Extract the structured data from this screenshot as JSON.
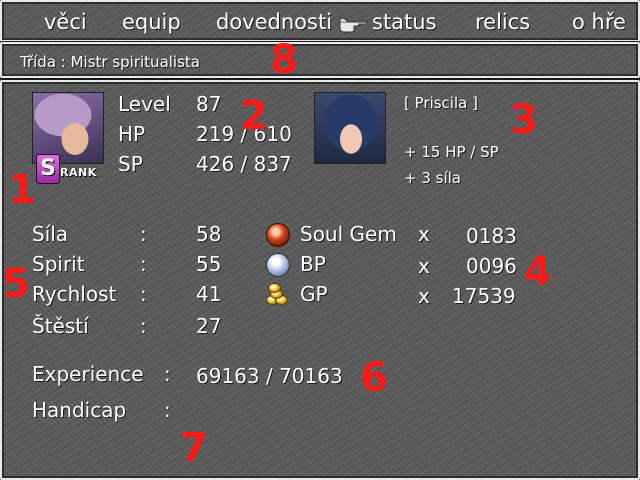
{
  "menu": {
    "items": [
      "věci",
      "equip",
      "dovednosti",
      "status",
      "relics",
      "o hře"
    ],
    "selected": "status",
    "cursor_icon": "pointing-hand-icon"
  },
  "class_bar": {
    "text": "Třída : Mistr spiritualista"
  },
  "character": {
    "rank_letter": "S",
    "rank_label": "RANK",
    "level_label": "Level",
    "level_value": "87",
    "hp_label": "HP",
    "hp_value": "219 / 610",
    "sp_label": "SP",
    "sp_value": "426 / 837"
  },
  "ally": {
    "name": "[ Priscila ]",
    "bonus_1": "+ 15 HP / SP",
    "bonus_2": "+ 3 síla"
  },
  "attributes": [
    {
      "label": "Síla",
      "sep": ":",
      "value": "58"
    },
    {
      "label": "Spirit",
      "sep": ":",
      "value": "55"
    },
    {
      "label": "Rychlost",
      "sep": ":",
      "value": "41"
    },
    {
      "label": "Štěstí",
      "sep": ":",
      "value": "27"
    }
  ],
  "inventory": [
    {
      "name": "Soul Gem",
      "x": "x",
      "count": "0183",
      "icon": "soul-gem-icon"
    },
    {
      "name": "BP",
      "x": "x",
      "count": "0096",
      "icon": "bp-orb-icon"
    },
    {
      "name": "GP",
      "x": "x",
      "count": "17539",
      "icon": "gold-coins-icon"
    }
  ],
  "experience": {
    "label": "Experience",
    "sep": ":",
    "value": "69163 / 70163"
  },
  "handicap": {
    "label": "Handicap",
    "sep": ":",
    "value": ""
  },
  "markers": [
    "1",
    "2",
    "3",
    "4",
    "5",
    "6",
    "7",
    "8"
  ],
  "colors": {
    "marker": "#ff1a1a",
    "panel": "#5a5a5a",
    "border": "#e8e8e8",
    "text": "#ffffff"
  }
}
